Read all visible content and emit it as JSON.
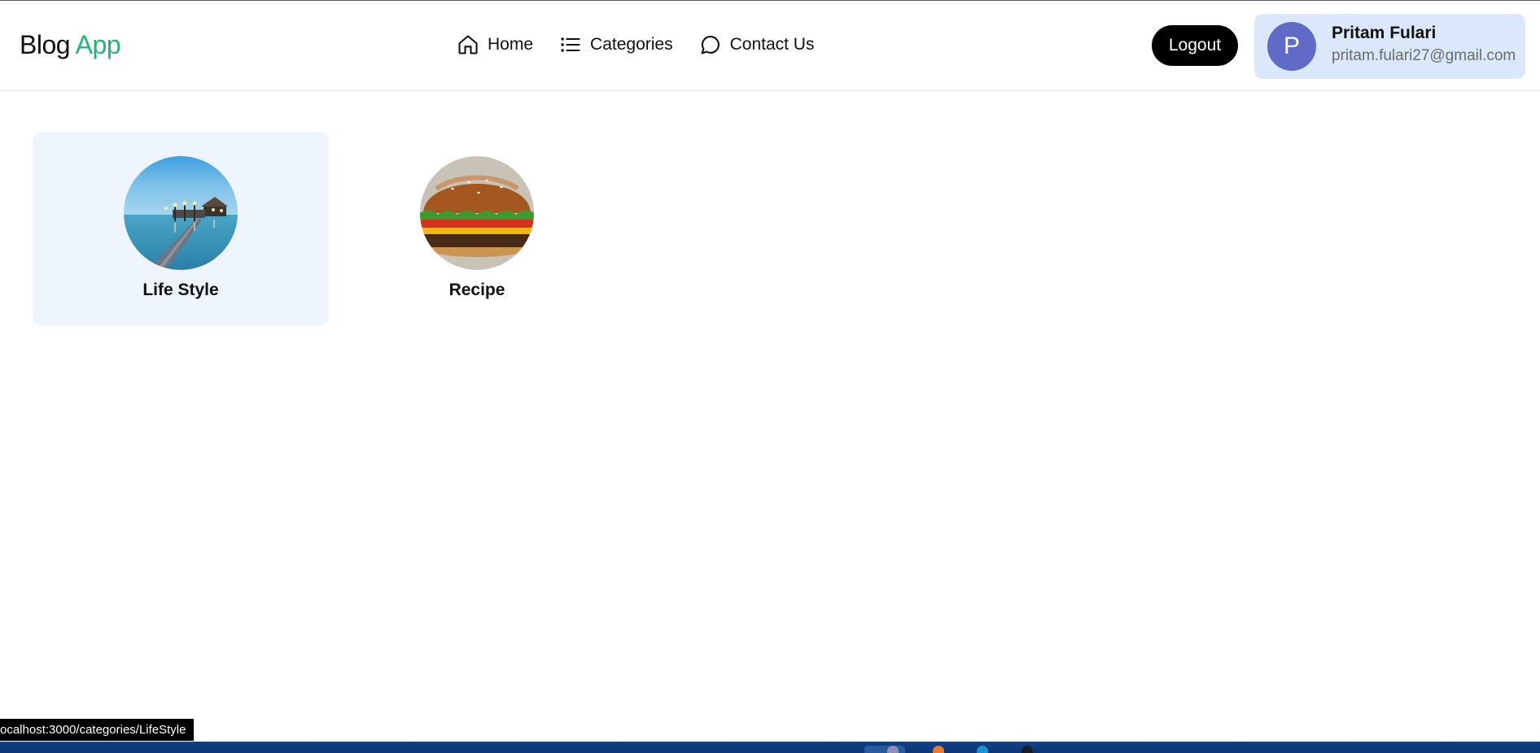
{
  "app": {
    "logo_part1": "Blog",
    "logo_part2": "App",
    "brand_color": "#22b573"
  },
  "nav": {
    "items": [
      {
        "label": "Home",
        "icon": "home-icon"
      },
      {
        "label": "Categories",
        "icon": "list-icon"
      },
      {
        "label": "Contact Us",
        "icon": "chat-bubble-icon"
      }
    ]
  },
  "header": {
    "logout_label": "Logout"
  },
  "user": {
    "initial": "P",
    "name": "Pritam Fulari",
    "email": "pritam.fulari27@gmail.com",
    "avatar_color": "#5f6bc6"
  },
  "categories": [
    {
      "label": "Life Style",
      "image": "pier-at-dusk-photo",
      "active": true
    },
    {
      "label": "Recipe",
      "image": "burger-photo",
      "active": false
    }
  ],
  "status_bar": {
    "url": "ocalhost:3000/categories/LifeStyle"
  }
}
